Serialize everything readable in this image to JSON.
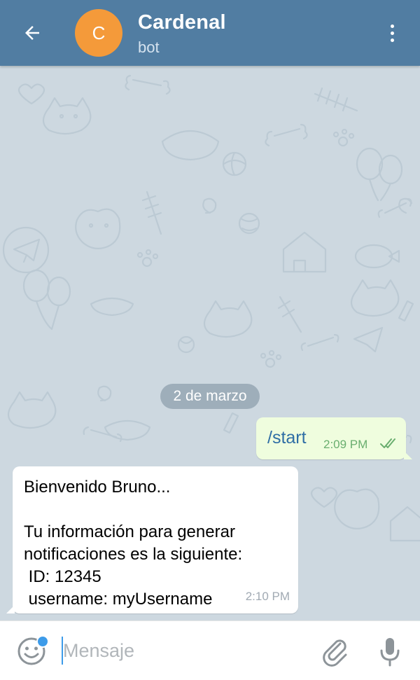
{
  "header": {
    "back_icon": "arrow-left-icon",
    "avatar_initial": "C",
    "title": "Cardenal",
    "subtitle": "bot",
    "menu_icon": "more-vertical-icon",
    "background_color": "#517da2",
    "avatar_color": "#f49a3a"
  },
  "chat": {
    "date_label": "2 de marzo",
    "messages": [
      {
        "direction": "outgoing",
        "text": "/start",
        "time": "2:09 PM",
        "status_icon": "double-check-icon"
      },
      {
        "direction": "incoming",
        "text": "Bienvenido Bruno...\n\nTu información para generar\nnotificaciones es la siguiente:\n ID: 12345\n username: myUsername",
        "time": "2:10 PM"
      }
    ]
  },
  "input_bar": {
    "emoji_icon": "smiley-icon",
    "placeholder": "Mensaje",
    "value": "",
    "attach_icon": "paperclip-icon",
    "mic_icon": "microphone-icon"
  }
}
